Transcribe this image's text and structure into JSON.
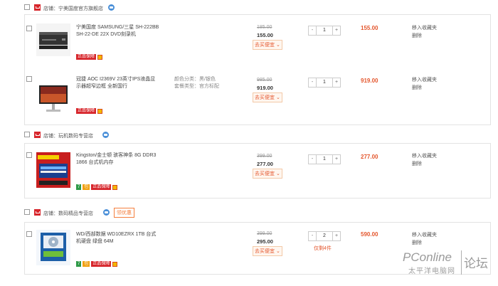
{
  "shops": [
    {
      "name": "店铺：宁美国度官方旗舰店",
      "items": [
        {
          "title": "宁美国度 SAMSUNG/三星 SH-222BB SH-22-DE 22X DVD刻录机",
          "old_price": "185.00",
          "price": "155.00",
          "promo_label": "去买便宜 ⌄",
          "qty": "1",
          "subtotal": "155.00",
          "op_fav": "移入收藏夹",
          "op_del": "删除",
          "badge_text": "正品保障"
        },
        {
          "title": "冠捷 AOC I2369V 23英寸IPS液晶显示器超窄边框 全新国行",
          "attr_color": "颜色分类：黑/银色",
          "attr_pkg": "套餐类型：官方标配",
          "old_price": "985.00",
          "price": "919.00",
          "promo_label": "去买便宜 ⌄",
          "qty": "1",
          "subtotal": "919.00",
          "op_fav": "移入收藏夹",
          "op_del": "删除",
          "badge_text": "正品保障"
        }
      ]
    },
    {
      "name": "店铺：玩机数码专营店",
      "items": [
        {
          "title": "Kingston/金士顿 骇客神条 8G DDR3 1866 台式机内存",
          "old_price": "399.00",
          "price": "277.00",
          "promo_label": "去买便宜 ⌄",
          "qty": "1",
          "subtotal": "277.00",
          "op_fav": "移入收藏夹",
          "op_del": "删除",
          "badge_7": "7",
          "badge_dd": "包",
          "badge_text": "正品保障"
        }
      ]
    },
    {
      "name": "店铺：数码精品专营店",
      "coupon": "领优惠",
      "items": [
        {
          "title": "WD/西部数据 WD10EZRX 1TB 台式机硬盘 绿盘 64M",
          "old_price": "399.00",
          "price": "295.00",
          "promo_label": "去买便宜 ⌄",
          "qty": "2",
          "stock": "仅剩4件",
          "subtotal": "590.00",
          "op_fav": "移入收藏夹",
          "op_del": "删除",
          "badge_7": "7",
          "badge_dd": "包",
          "badge_text": "正品保障"
        }
      ]
    }
  ],
  "watermark": {
    "brand": "PConline",
    "cn": "太平洋电脑网",
    "forum": "论坛"
  },
  "colors": {
    "accent": "#e4572e",
    "shop_icon": "#d7262c",
    "border": "#e3e3e3"
  },
  "icons": [
    "checkbox-icon",
    "shop-icon",
    "chat-icon",
    "flag-icon",
    "minus-icon",
    "plus-icon"
  ]
}
